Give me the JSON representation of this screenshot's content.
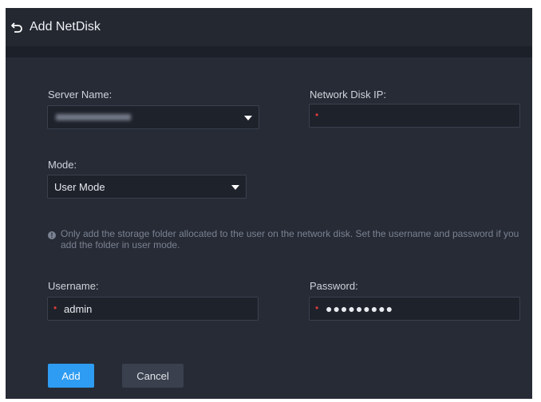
{
  "header": {
    "title": "Add NetDisk",
    "back_icon": "back-arrow-icon"
  },
  "form": {
    "server_name": {
      "label": "Server Name:"
    },
    "network_disk_ip": {
      "label": "Network Disk IP:",
      "value": ""
    },
    "mode": {
      "label": "Mode:",
      "value": "User Mode"
    },
    "notice": "Only add the storage folder allocated to the user on the network disk. Set the username and password if you add the folder in user mode.",
    "username": {
      "label": "Username:",
      "value": "admin"
    },
    "password": {
      "label": "Password:",
      "value": "●●●●●●●●●"
    }
  },
  "buttons": {
    "add": "Add",
    "cancel": "Cancel"
  },
  "colors": {
    "background": "#262b36",
    "header": "#242831",
    "accent": "#2e9cf2",
    "required": "#e03b3b"
  }
}
